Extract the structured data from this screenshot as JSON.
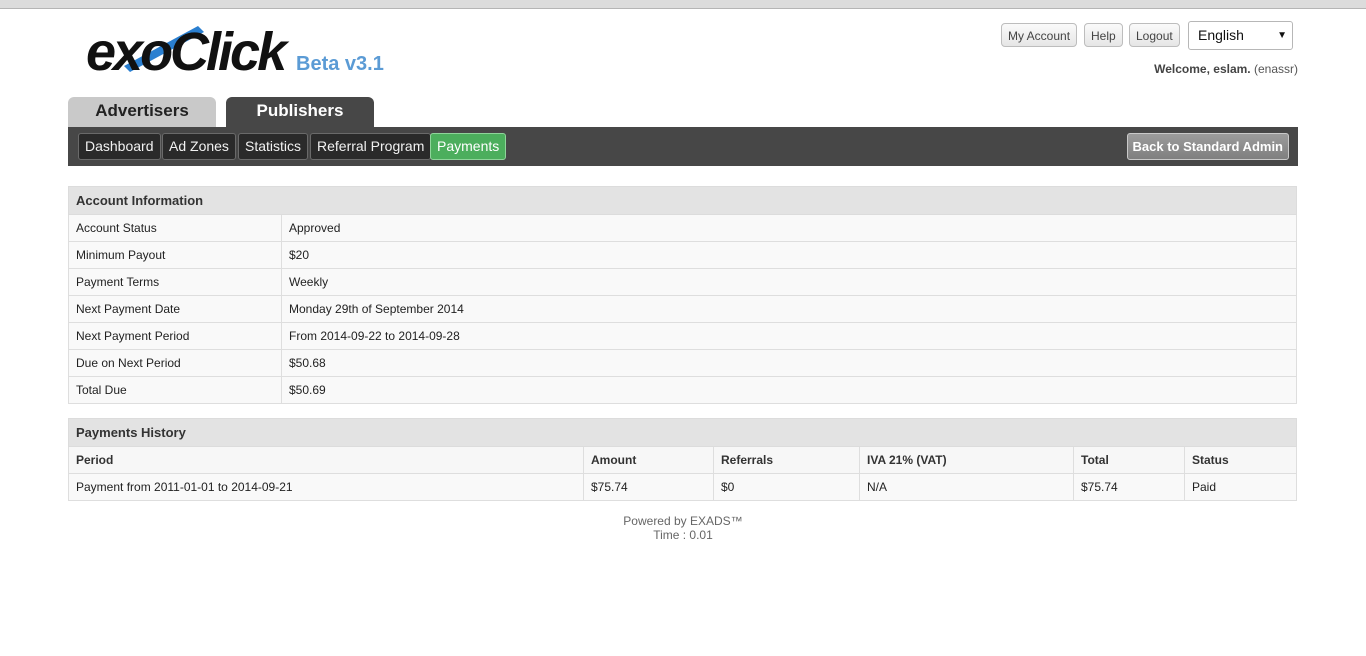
{
  "brand": {
    "logo_text": "exoClick",
    "version": "Beta v3.1"
  },
  "top_links": {
    "my_account": "My Account",
    "help": "Help",
    "logout": "Logout"
  },
  "language": {
    "selected": "English"
  },
  "welcome": {
    "prefix": "Welcome, eslam.",
    "username": "(enassr)"
  },
  "main_tabs": {
    "advertisers": "Advertisers",
    "publishers": "Publishers"
  },
  "subnav": {
    "items": [
      "Dashboard",
      "Ad Zones",
      "Statistics",
      "Referral Program",
      "Payments"
    ],
    "back_label": "Back to Standard Admin"
  },
  "account_info": {
    "title": "Account Information",
    "rows": [
      {
        "label": "Account Status",
        "value": "Approved"
      },
      {
        "label": "Minimum Payout",
        "value": "$20"
      },
      {
        "label": "Payment Terms",
        "value": "Weekly"
      },
      {
        "label": "Next Payment Date",
        "value": "Monday 29th of September 2014"
      },
      {
        "label": "Next Payment Period",
        "value": "From 2014-09-22 to 2014-09-28"
      },
      {
        "label": "Due on Next Period",
        "value": "$50.68"
      },
      {
        "label": "Total Due",
        "value": "$50.69"
      }
    ]
  },
  "payments_history": {
    "title": "Payments History",
    "columns": [
      "Period",
      "Amount",
      "Referrals",
      "IVA 21% (VAT)",
      "Total",
      "Status"
    ],
    "rows": [
      [
        "Payment from 2011-01-01 to 2014-09-21",
        "$75.74",
        "$0",
        "N/A",
        "$75.74",
        "Paid"
      ]
    ]
  },
  "footer": {
    "powered_by": "Powered by EXADS™",
    "time": "Time : 0.01"
  },
  "colors": {
    "beta": "#5b9bd5",
    "nav_dark": "#474747",
    "active_tab": "#4cae5d"
  }
}
